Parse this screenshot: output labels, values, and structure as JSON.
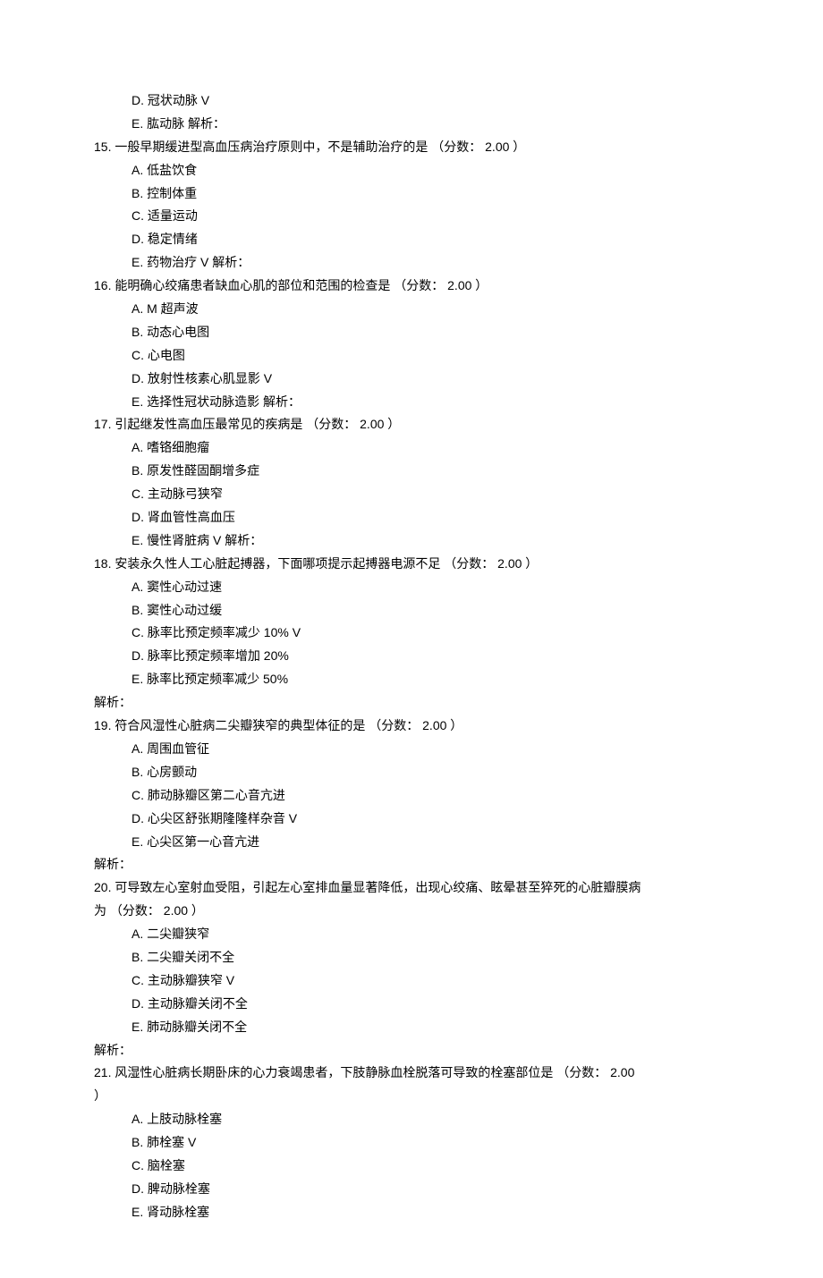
{
  "pre_options": [
    {
      "letter": "D.",
      "text": "冠状动脉  V"
    },
    {
      "letter": "E.",
      "text": "肱动脉  解析："
    }
  ],
  "questions": [
    {
      "num": "15.",
      "stem": "一般早期缓进型高血压病治疗原则中，不是辅助治疗的是  （分数：  2.00 ）",
      "opts": [
        {
          "letter": "A.",
          "text": "低盐饮食"
        },
        {
          "letter": "B.",
          "text": "控制体重"
        },
        {
          "letter": "C.",
          "text": "适量运动"
        },
        {
          "letter": "D.",
          "text": "稳定情绪"
        },
        {
          "letter": "E.",
          "text": "药物治疗  V 解析："
        }
      ],
      "post": ""
    },
    {
      "num": "16.",
      "stem": "能明确心绞痛患者缺血心肌的部位和范围的检查是  （分数：  2.00 ）",
      "opts": [
        {
          "letter": "A.",
          "text": "M 超声波"
        },
        {
          "letter": "B.",
          "text": "动态心电图"
        },
        {
          "letter": "C.",
          "text": "心电图"
        },
        {
          "letter": "D.",
          "text": "放射性核素心肌显影  V"
        },
        {
          "letter": "E.",
          "text": "选择性冠状动脉造影  解析："
        }
      ],
      "post": ""
    },
    {
      "num": "17.",
      "stem": "引起继发性高血压最常见的疾病是  （分数：  2.00 ）",
      "opts": [
        {
          "letter": "A.",
          "text": "嗜铬细胞瘤"
        },
        {
          "letter": "B.",
          "text": "原发性醛固酮增多症"
        },
        {
          "letter": "C.",
          "text": "主动脉弓狭窄"
        },
        {
          "letter": "D.",
          "text": "肾血管性高血压"
        },
        {
          "letter": "E.",
          "text": "慢性肾脏病  V 解析："
        }
      ],
      "post": ""
    },
    {
      "num": "18.",
      "stem": "安装永久性人工心脏起搏器，下面哪项提示起搏器电源不足  （分数：  2.00 ）",
      "opts": [
        {
          "letter": "A.",
          "text": "窦性心动过速"
        },
        {
          "letter": "B.",
          "text": "窦性心动过缓"
        },
        {
          "letter": "C.",
          "text": "脉率比预定频率减少  10% V"
        },
        {
          "letter": "D.",
          "text": "脉率比预定频率增加  20%"
        },
        {
          "letter": "E.",
          "text": "脉率比预定频率减少  50%"
        }
      ],
      "post": "解析："
    },
    {
      "num": "19.",
      "stem": "符合风湿性心脏病二尖瓣狭窄的典型体征的是  （分数：  2.00 ）",
      "opts": [
        {
          "letter": "A.",
          "text": "周围血管征"
        },
        {
          "letter": "B.",
          "text": "心房颤动"
        },
        {
          "letter": "C.",
          "text": "肺动脉瓣区第二心音亢进"
        },
        {
          "letter": "D.",
          "text": "心尖区舒张期隆隆样杂音      V"
        },
        {
          "letter": "E.",
          "text": "心尖区第一心音亢进"
        }
      ],
      "post": "解析："
    },
    {
      "num": "20.",
      "stem": "可导致左心室射血受阻，引起左心室排血量显著降低，出现心绞痛、眩晕甚至猝死的心脏瓣膜病",
      "stem2": "为  （分数：  2.00 ）",
      "opts": [
        {
          "letter": "A.",
          "text": "二尖瓣狭窄"
        },
        {
          "letter": "B.",
          "text": "二尖瓣关闭不全"
        },
        {
          "letter": "C.",
          "text": "主动脉瓣狭窄  V"
        },
        {
          "letter": "D.",
          "text": "主动脉瓣关闭不全"
        },
        {
          "letter": "E.",
          "text": "肺动脉瓣关闭不全"
        }
      ],
      "post": "解析："
    },
    {
      "num": "21.",
      "stem": "风湿性心脏病长期卧床的心力衰竭患者，下肢静脉血栓脱落可导致的栓塞部位是  （分数：  2.00",
      "stem2": "）",
      "opts": [
        {
          "letter": "A.",
          "text": "上肢动脉栓塞"
        },
        {
          "letter": "B.",
          "text": "肺栓塞  V"
        },
        {
          "letter": "C.",
          "text": "脑栓塞"
        },
        {
          "letter": "D.",
          "text": "脾动脉栓塞"
        },
        {
          "letter": "E.",
          "text": "肾动脉栓塞"
        }
      ],
      "post": ""
    }
  ]
}
